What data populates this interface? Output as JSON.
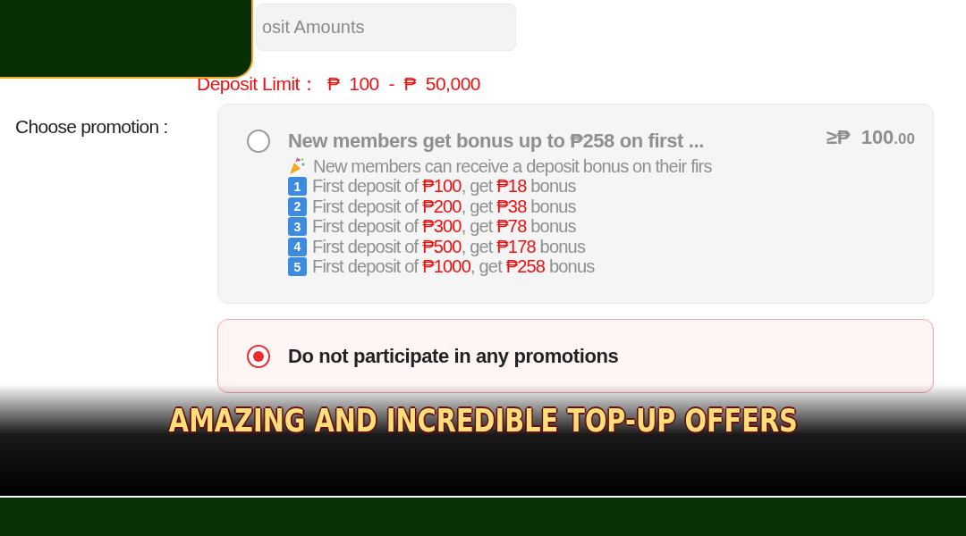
{
  "deposit_field": {
    "placeholder": "osit Amounts"
  },
  "deposit_limit": "Deposit Limit：  ₱  100  -  ₱  50,000",
  "promotion_label": "Choose promotion :",
  "promotions": [
    {
      "kind": "offer",
      "selected": false,
      "title": "New members get bonus up to ₱258 on first ...",
      "min_amount": "≥₱  100",
      "min_cents": ".00",
      "intro": "New members can receive a deposit bonus on their firs",
      "lines": [
        {
          "badge": "1",
          "prefix": "First deposit of ",
          "amount": "₱100",
          "middle": ", get ",
          "bonus": "₱18",
          "suffix": " bonus"
        },
        {
          "badge": "2",
          "prefix": "First deposit of ",
          "amount": "₱200",
          "middle": ", get ",
          "bonus": "₱38",
          "suffix": " bonus"
        },
        {
          "badge": "3",
          "prefix": "First deposit of ",
          "amount": "₱300",
          "middle": ", get ",
          "bonus": "₱78",
          "suffix": " bonus"
        },
        {
          "badge": "4",
          "prefix": "First deposit of ",
          "amount": "₱500",
          "middle": ", get ",
          "bonus": "₱178",
          "suffix": " bonus"
        },
        {
          "badge": "5",
          "prefix": "First deposit of ",
          "amount": "₱1000",
          "middle": ", get ",
          "bonus": "₱258",
          "suffix": " bonus"
        }
      ]
    },
    {
      "kind": "none",
      "selected": true,
      "title": "Do not participate in any promotions"
    }
  ],
  "banner": {
    "caption": "AMAZING AND INCREDIBLE TOP-UP OFFERS"
  }
}
